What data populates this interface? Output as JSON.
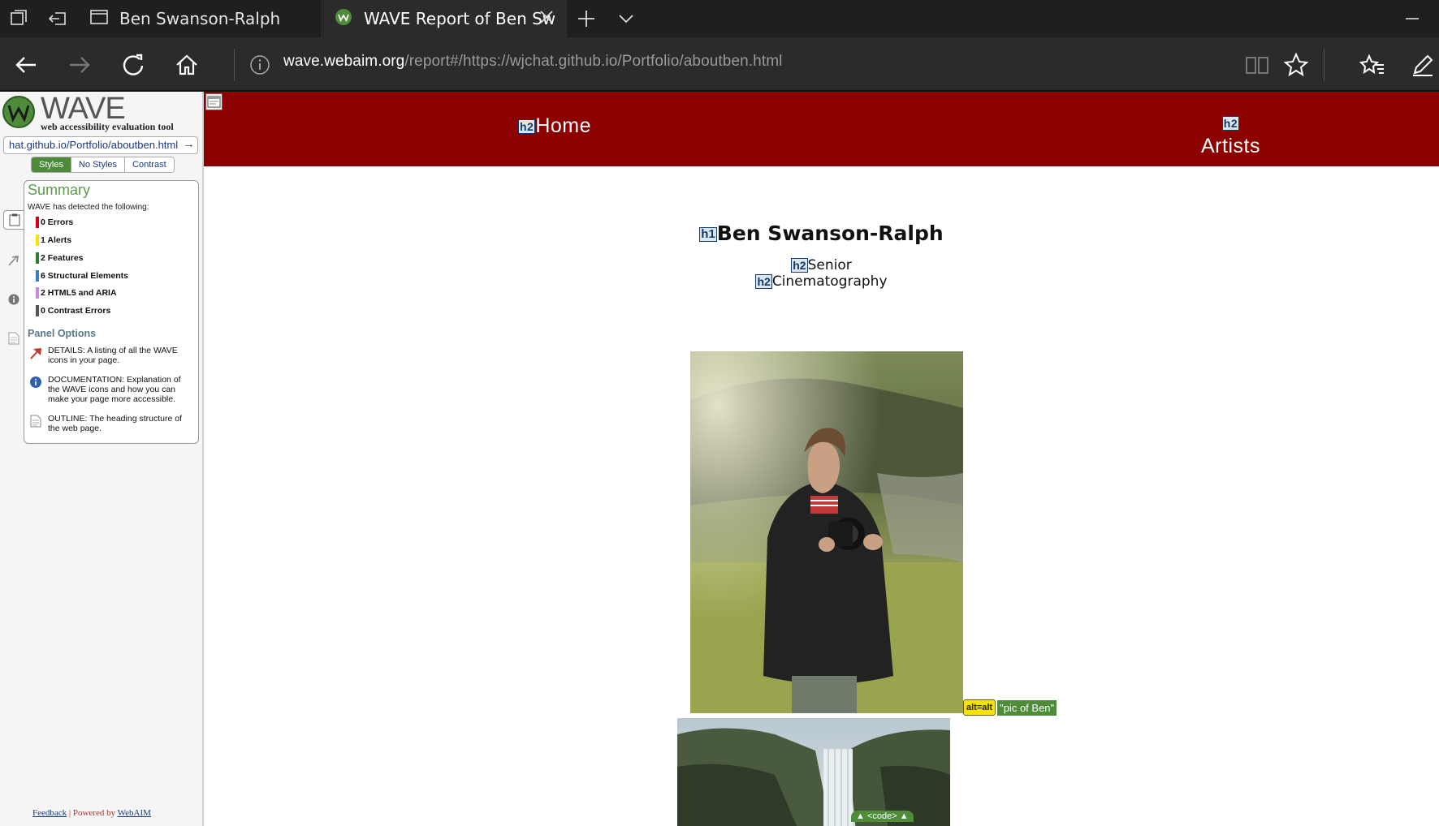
{
  "browser": {
    "tabs": [
      {
        "title": "Ben Swanson-Ralph",
        "active": false
      },
      {
        "title": "WAVE Report of Ben Sw",
        "active": true
      }
    ],
    "url_host": "wave.webaim.org",
    "url_path": "/report#/https://wjchat.github.io/Portfolio/aboutben.html"
  },
  "wave": {
    "title": "WAVE",
    "subtitle": "web accessibility evaluation tool",
    "url_field": "hat.github.io/Portfolio/aboutben.html",
    "view_tabs": [
      "Styles",
      "No Styles",
      "Contrast"
    ],
    "active_view": "Styles",
    "summary": {
      "title": "Summary",
      "detected_text": "WAVE has detected the following:",
      "counts": [
        {
          "label": "0 Errors",
          "color": "#d0021b"
        },
        {
          "label": "1 Alerts",
          "color": "#f5e400"
        },
        {
          "label": "2 Features",
          "color": "#2e7d32"
        },
        {
          "label": "6 Structural Elements",
          "color": "#3a7dc9"
        },
        {
          "label": "2 HTML5 and ARIA",
          "color": "#c58ad8"
        },
        {
          "label": "0 Contrast Errors",
          "color": "#555555"
        }
      ]
    },
    "panel_options": {
      "title": "Panel Options",
      "items": [
        {
          "text": "DETAILS: A listing of all the WAVE icons in your page."
        },
        {
          "text": "DOCUMENTATION: Explanation of the WAVE icons and how you can make your page more accessible."
        },
        {
          "text": "OUTLINE: The heading structure of the web page."
        }
      ]
    },
    "footer": {
      "feedback": "Feedback",
      "powered": " | Powered by ",
      "webaim": "WebAIM"
    }
  },
  "page": {
    "nav": {
      "home": "Home",
      "artists": "Artists",
      "h2_tag": "h2"
    },
    "h1_tag": "h1",
    "h2_tag": "h2",
    "name": "Ben Swanson-Ralph",
    "subtitle1": "Senior",
    "subtitle2": "Cinematography",
    "alt_icon": "alt=alt",
    "alt_text": "\"pic of Ben\"",
    "code_tag": "▲ <code> ▲"
  },
  "colors": {
    "nav_bg": "#8c0000",
    "wave_green": "#4e8c3a"
  }
}
